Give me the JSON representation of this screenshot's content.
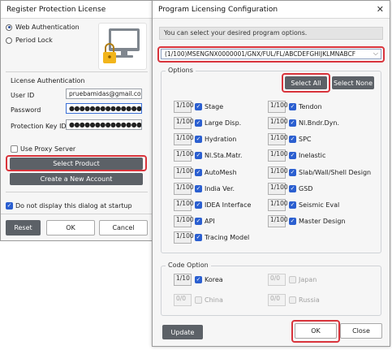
{
  "register": {
    "title": "Register Protection License",
    "web_auth": "Web Authentication",
    "period_lock": "Period Lock",
    "license_auth": "License Authentication",
    "user_id_label": "User ID",
    "user_id_value": "pruebamidas@gmail.com",
    "password_label": "Password",
    "password_value": "●●●●●●●●●●●●●●●",
    "key_label": "Protection Key ID",
    "key_value": "●●●●●●●●●●●●●●●",
    "use_proxy": "Use Proxy Server",
    "select_product": "Select Product",
    "create_account": "Create a New Account",
    "dont_display": "Do not display this dialog at startup",
    "reset": "Reset",
    "ok": "OK",
    "cancel": "Cancel"
  },
  "config": {
    "title": "Program Licensing Configuration",
    "info": "You can select your desired program options.",
    "product": "(1/100)MSENGNX0000001/GNX/FUL/FL/ABCDEFGHIJKLMNABCF",
    "options_title": "Options",
    "select_all": "Select All",
    "select_none": "Select None",
    "options_left": [
      {
        "lic": "1/100",
        "label": "Stage"
      },
      {
        "lic": "1/100",
        "label": "Large Disp."
      },
      {
        "lic": "1/100",
        "label": "Hydration"
      },
      {
        "lic": "1/100",
        "label": "Nl.Sta.Matr."
      },
      {
        "lic": "1/100",
        "label": "AutoMesh"
      },
      {
        "lic": "1/100",
        "label": "India Ver."
      },
      {
        "lic": "1/100",
        "label": "IDEA Interface"
      },
      {
        "lic": "1/100",
        "label": "API"
      },
      {
        "lic": "1/100",
        "label": "Tracing Model"
      }
    ],
    "options_right": [
      {
        "lic": "1/100",
        "label": "Tendon"
      },
      {
        "lic": "1/100",
        "label": "Nl.Bndr.Dyn."
      },
      {
        "lic": "1/100",
        "label": "SPC"
      },
      {
        "lic": "1/100",
        "label": "Inelastic"
      },
      {
        "lic": "1/100",
        "label": "Slab/Wall/Shell Design"
      },
      {
        "lic": "1/100",
        "label": "GSD"
      },
      {
        "lic": "1/100",
        "label": "Seismic Eval"
      },
      {
        "lic": "1/100",
        "label": "Master Design"
      }
    ],
    "code_title": "Code Option",
    "codes": [
      {
        "lic": "1/10",
        "label": "Korea",
        "enabled": true
      },
      {
        "lic": "0/0",
        "label": "Japan",
        "enabled": false
      },
      {
        "lic": "0/0",
        "label": "China",
        "enabled": false
      },
      {
        "lic": "0/0",
        "label": "Russia",
        "enabled": false
      }
    ],
    "update": "Update",
    "ok": "OK",
    "close": "Close"
  }
}
